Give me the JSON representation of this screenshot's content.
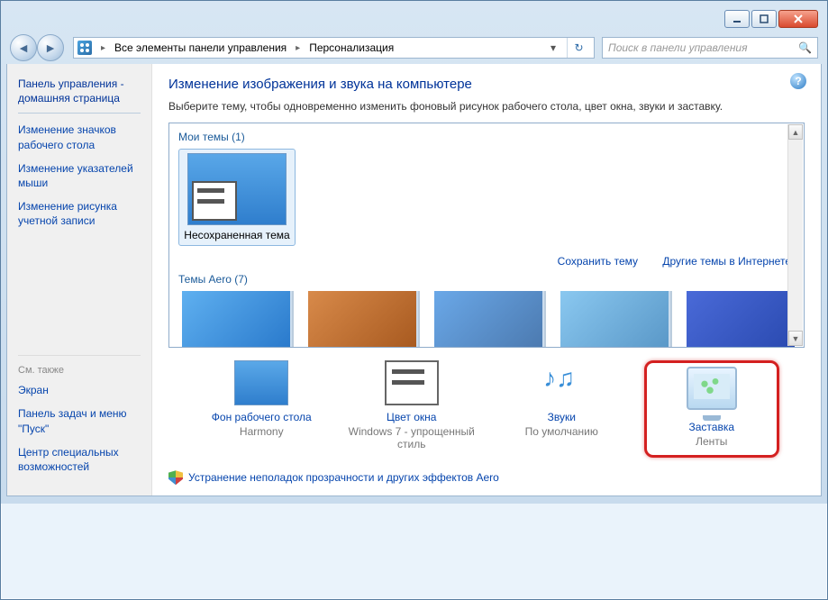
{
  "breadcrumb": {
    "item1": "Все элементы панели управления",
    "item2": "Персонализация"
  },
  "search": {
    "placeholder": "Поиск в панели управления"
  },
  "sidebar": {
    "home": "Панель управления - домашняя страница",
    "links": {
      "l0": "Изменение значков рабочего стола",
      "l1": "Изменение указателей мыши",
      "l2": "Изменение рисунка учетной записи"
    },
    "seealso": "См. также",
    "also": {
      "a0": "Экран",
      "a1": "Панель задач и меню \"Пуск\"",
      "a2": "Центр специальных возможностей"
    }
  },
  "main": {
    "heading": "Изменение изображения и звука на компьютере",
    "desc": "Выберите тему, чтобы одновременно изменить фоновый рисунок рабочего стола, цвет окна, звуки и заставку.",
    "section_my": "Мои темы (1)",
    "theme_name": "Несохраненная тема",
    "save_link": "Сохранить тему",
    "more_link": "Другие темы в Интернете",
    "section_aero": "Темы Aero (7)"
  },
  "bottom": {
    "bg": {
      "title": "Фон рабочего стола",
      "sub": "Harmony"
    },
    "color": {
      "title": "Цвет окна",
      "sub": "Windows 7 - упрощенный стиль"
    },
    "sound": {
      "title": "Звуки",
      "sub": "По умолчанию"
    },
    "saver": {
      "title": "Заставка",
      "sub": "Ленты"
    }
  },
  "footer_link": "Устранение неполадок прозрачности и других эффектов Aero"
}
